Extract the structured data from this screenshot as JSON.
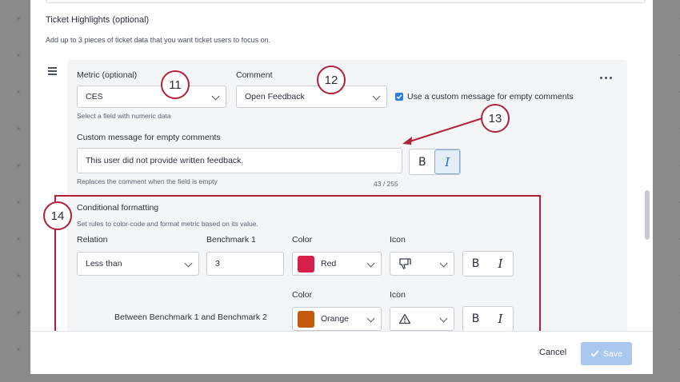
{
  "section": {
    "title": "Ticket Highlights (optional)",
    "description": "Add up to 3 pieces of ticket data that you want ticket users to focus on."
  },
  "metric": {
    "label": "Metric (optional)",
    "value": "CES",
    "hint": "Select a field with numeric data"
  },
  "comment": {
    "label": "Comment",
    "value": "Open Feedback"
  },
  "custom_message_checkbox": {
    "label": "Use a custom message for empty comments",
    "checked": true
  },
  "custom_message": {
    "label": "Custom message for empty comments",
    "value": "This user did not provide written feedback.",
    "hint": "Replaces the comment when the field is empty",
    "counter": "43 / 255"
  },
  "format": {
    "bold": "B",
    "italic": "I"
  },
  "conditional": {
    "title": "Conditional formatting",
    "description": "Set rules to color-code and format metric based on its value.",
    "headers": {
      "relation": "Relation",
      "benchmark1": "Benchmark 1",
      "color": "Color",
      "icon": "Icon"
    },
    "rule1": {
      "relation": "Less than",
      "benchmark": "3",
      "color_name": "Red",
      "color_hex": "#d61f4a",
      "icon": "thumbs-down-icon"
    },
    "rule2": {
      "relation": "Between Benchmark 1 and Benchmark 2",
      "color_name": "Orange",
      "color_hex": "#c45a0e",
      "icon": "warning-icon"
    }
  },
  "callouts": {
    "c11": "11",
    "c12": "12",
    "c13": "13",
    "c14": "14"
  },
  "footer": {
    "cancel": "Cancel",
    "save": "Save"
  },
  "colors": {
    "accent": "#2f7de1",
    "callout": "#b3203a",
    "save_disabled": "#a8c8ef"
  }
}
